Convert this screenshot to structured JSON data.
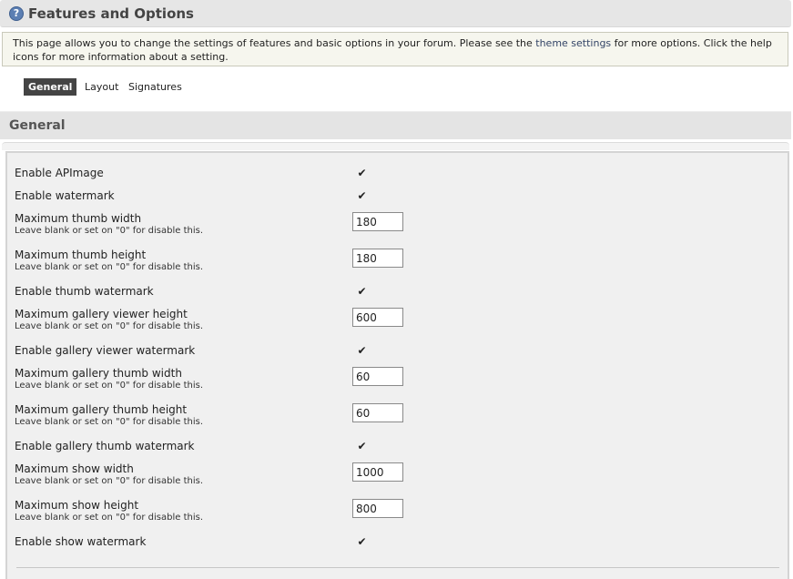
{
  "header": {
    "title": "Features and Options",
    "help_icon": "question-circle-icon"
  },
  "description": {
    "before": "This page allows you to change the settings of features and basic options in your forum. Please see the ",
    "link": "theme settings",
    "after": " for more options. Click the help icons for more information about a setting."
  },
  "tabs": [
    "General",
    "Layout",
    "Signatures"
  ],
  "section": {
    "title": "General"
  },
  "settings": [
    {
      "label": "Enable APImage",
      "type": "checkbox",
      "checked": true
    },
    {
      "label": "Enable watermark",
      "type": "checkbox",
      "checked": true
    },
    {
      "label": "Maximum thumb width",
      "hint": "Leave blank or set on \"0\" for disable this.",
      "type": "text",
      "value": "180"
    },
    {
      "label": "Maximum thumb height",
      "hint": "Leave blank or set on \"0\" for disable this.",
      "type": "text",
      "value": "180"
    },
    {
      "label": "Enable thumb watermark",
      "type": "checkbox",
      "checked": true
    },
    {
      "label": "Maximum gallery viewer height",
      "hint": "Leave blank or set on \"0\" for disable this.",
      "type": "text",
      "value": "600"
    },
    {
      "label": "Enable gallery viewer watermark",
      "type": "checkbox",
      "checked": true
    },
    {
      "label": "Maximum gallery thumb width",
      "hint": "Leave blank or set on \"0\" for disable this.",
      "type": "text",
      "value": "60"
    },
    {
      "label": "Maximum gallery thumb height",
      "hint": "Leave blank or set on \"0\" for disable this.",
      "type": "text",
      "value": "60"
    },
    {
      "label": "Enable gallery thumb watermark",
      "type": "checkbox",
      "checked": true
    },
    {
      "label": "Maximum show width",
      "hint": "Leave blank or set on \"0\" for disable this.",
      "type": "text",
      "value": "1000"
    },
    {
      "label": "Maximum show height",
      "hint": "Leave blank or set on \"0\" for disable this.",
      "type": "text",
      "value": "800"
    },
    {
      "label": "Enable show watermark",
      "type": "checkbox",
      "checked": true
    }
  ]
}
